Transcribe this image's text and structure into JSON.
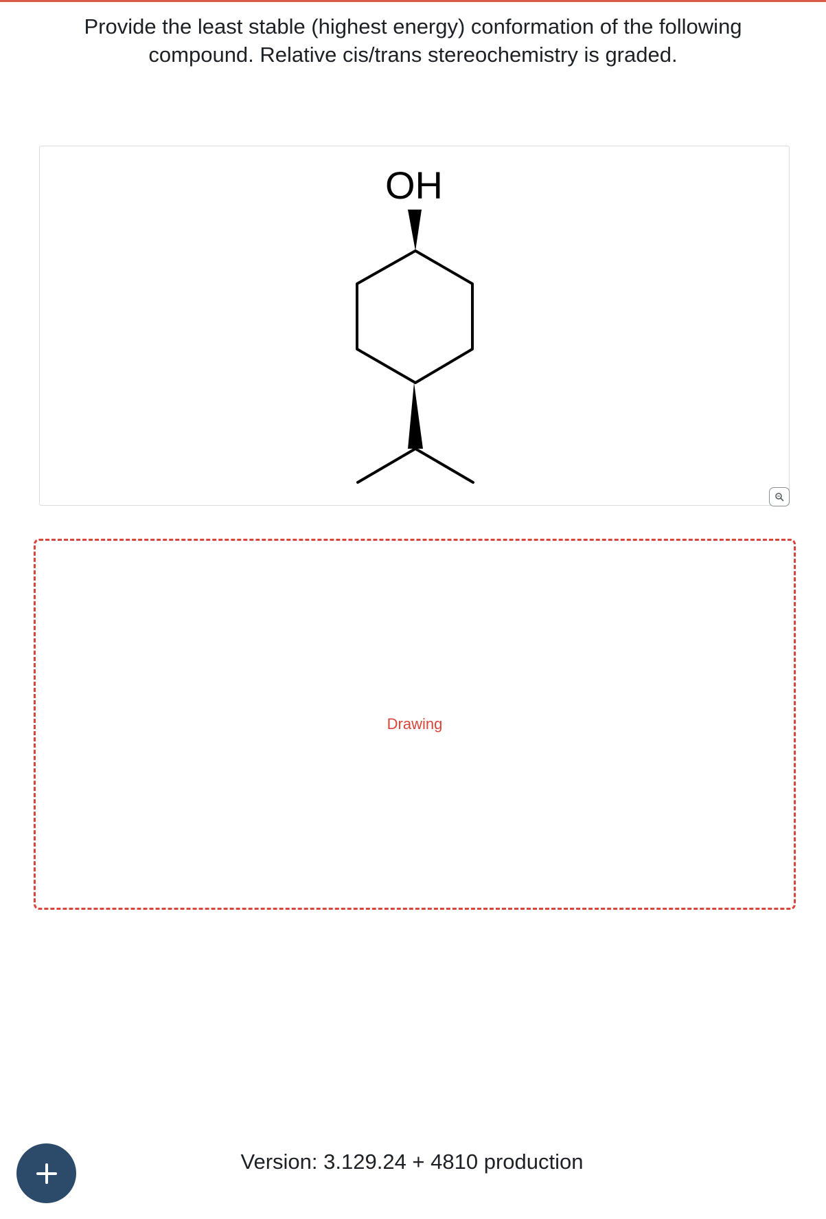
{
  "question": {
    "line1": "Provide the least stable (highest energy) conformation of the following",
    "line2": "compound. Relative cis/trans stereochemistry is graded."
  },
  "structure": {
    "substituent_label": "OH"
  },
  "zoom_button": {
    "icon": "zoom-icon"
  },
  "drawing_area": {
    "label": "Drawing",
    "accent_color": "#d8463a"
  },
  "add_button": {
    "icon": "plus-icon",
    "color": "#2c4b6b"
  },
  "footer": {
    "version_text": "Version: 3.129.24 + 4810 production"
  }
}
